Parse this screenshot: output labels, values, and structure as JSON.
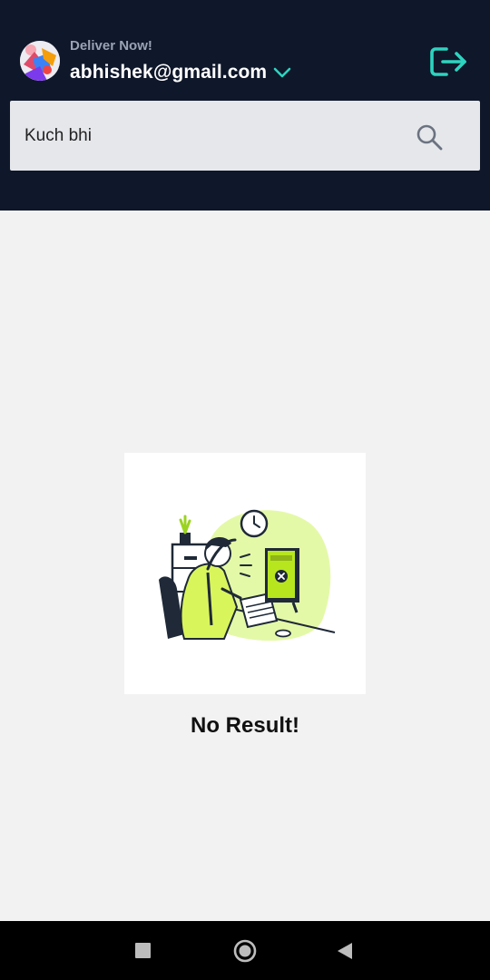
{
  "header": {
    "subtitle": "Deliver Now!",
    "email": "abhishek@gmail.com",
    "avatar_icon": "profile-avatar-icon",
    "dropdown_icon": "chevron-down-icon",
    "logout_icon": "logout-icon"
  },
  "search": {
    "value": "Kuch bhi",
    "placeholder": "",
    "icon": "search-icon"
  },
  "empty_state": {
    "illustration": "error-computer-illustration",
    "message": "No Result!"
  },
  "system_nav": {
    "recents_icon": "square-icon",
    "home_icon": "circle-icon",
    "back_icon": "triangle-back-icon"
  },
  "colors": {
    "header_bg": "#0f172a",
    "accent": "#2dd4bf",
    "illustration_green": "#c6f432",
    "page_bg": "#f2f2f2"
  }
}
